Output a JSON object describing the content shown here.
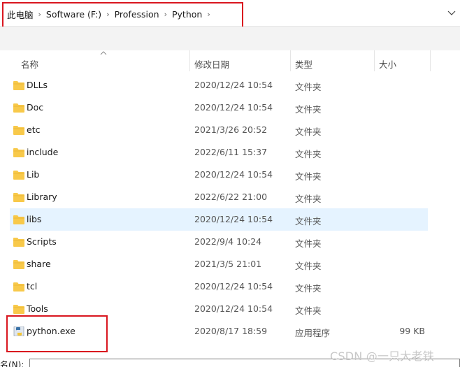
{
  "breadcrumb": {
    "items": [
      "此电脑",
      "Software (F:)",
      "Profession",
      "Python"
    ],
    "separator": "›"
  },
  "columns": {
    "name": "名称",
    "date": "修改日期",
    "type": "类型",
    "size": "大小"
  },
  "files": [
    {
      "name": "DLLs",
      "date": "2020/12/24 10:54",
      "type": "文件夹",
      "size": "",
      "icon": "folder-icon"
    },
    {
      "name": "Doc",
      "date": "2020/12/24 10:54",
      "type": "文件夹",
      "size": "",
      "icon": "folder-icon"
    },
    {
      "name": "etc",
      "date": "2021/3/26 20:52",
      "type": "文件夹",
      "size": "",
      "icon": "folder-icon"
    },
    {
      "name": "include",
      "date": "2022/6/11 15:37",
      "type": "文件夹",
      "size": "",
      "icon": "folder-icon"
    },
    {
      "name": "Lib",
      "date": "2020/12/24 10:54",
      "type": "文件夹",
      "size": "",
      "icon": "folder-icon"
    },
    {
      "name": "Library",
      "date": "2022/6/22 21:00",
      "type": "文件夹",
      "size": "",
      "icon": "folder-icon"
    },
    {
      "name": "libs",
      "date": "2020/12/24 10:54",
      "type": "文件夹",
      "size": "",
      "icon": "folder-icon",
      "selected": true
    },
    {
      "name": "Scripts",
      "date": "2022/9/4 10:24",
      "type": "文件夹",
      "size": "",
      "icon": "folder-icon"
    },
    {
      "name": "share",
      "date": "2021/3/5 21:01",
      "type": "文件夹",
      "size": "",
      "icon": "folder-icon"
    },
    {
      "name": "tcl",
      "date": "2020/12/24 10:54",
      "type": "文件夹",
      "size": "",
      "icon": "folder-icon"
    },
    {
      "name": "Tools",
      "date": "2020/12/24 10:54",
      "type": "文件夹",
      "size": "",
      "icon": "folder-icon"
    },
    {
      "name": "python.exe",
      "date": "2020/8/17 18:59",
      "type": "应用程序",
      "size": "99 KB",
      "icon": "python-exe-icon"
    }
  ],
  "filename_bar": {
    "label": "名(N):",
    "value": ""
  },
  "watermark": "CSDN @一只大老铁",
  "colors": {
    "selection": "#e5f3ff",
    "highlight_box": "#d9161f",
    "folder": "#f8c94a"
  }
}
